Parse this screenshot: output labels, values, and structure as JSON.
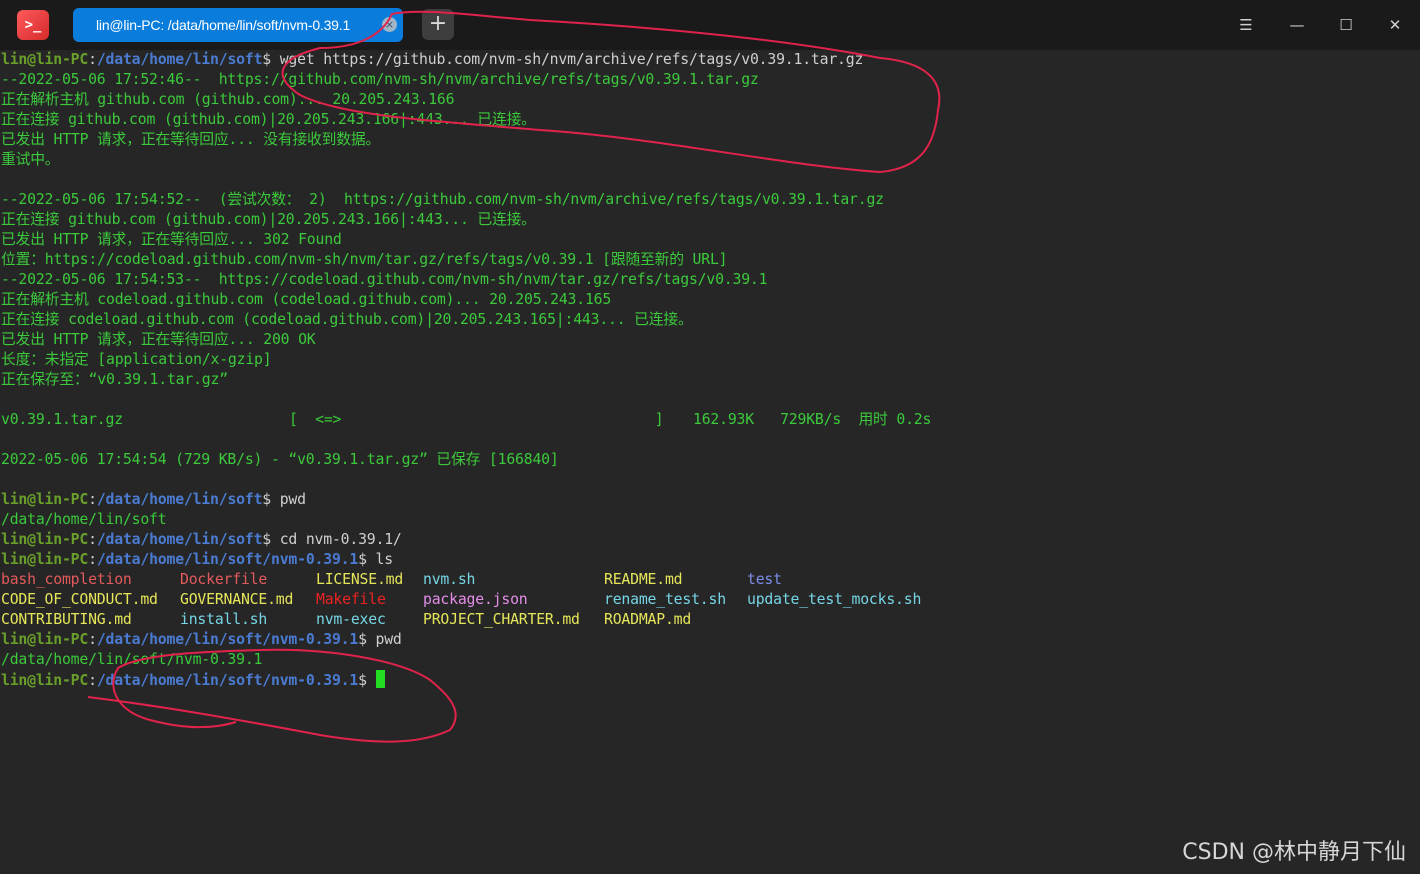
{
  "window": {
    "tab_title": "lin@lin-PC: /data/home/lin/soft/nvm-0.39.1",
    "tab_close": "×",
    "new_tab": "+",
    "menu": "☰",
    "minimize": "—",
    "maximize": "☐",
    "close": "✕"
  },
  "terminal": {
    "wget": {
      "user": "lin@lin-PC",
      "path": "/data/home/lin/soft",
      "cmd": "$ wget https://github.com/nvm-sh/nvm/archive/refs/tags/v0.39.1.tar.gz"
    },
    "l2": "--2022-05-06 17:52:46--  https://github.com/nvm-sh/nvm/archive/refs/tags/v0.39.1.tar.gz",
    "l3": "正在解析主机 github.com (github.com)... 20.205.243.166",
    "l4": "正在连接 github.com (github.com)|20.205.243.166|:443... 已连接。",
    "l5": "已发出 HTTP 请求，正在等待回应... 没有接收到数据。",
    "l6": "重试中。",
    "l7": "--2022-05-06 17:54:52--  (尝试次数： 2)  https://github.com/nvm-sh/nvm/archive/refs/tags/v0.39.1.tar.gz",
    "l8": "正在连接 github.com (github.com)|20.205.243.166|:443... 已连接。",
    "l9": "已发出 HTTP 请求，正在等待回应... 302 Found",
    "l10": "位置：https://codeload.github.com/nvm-sh/nvm/tar.gz/refs/tags/v0.39.1 [跟随至新的 URL]",
    "l11": "--2022-05-06 17:54:53--  https://codeload.github.com/nvm-sh/nvm/tar.gz/refs/tags/v0.39.1",
    "l12": "正在解析主机 codeload.github.com (codeload.github.com)... 20.205.243.165",
    "l13": "正在连接 codeload.github.com (codeload.github.com)|20.205.243.165|:443... 已连接。",
    "l14": "已发出 HTTP 请求，正在等待回应... 200 OK",
    "l15": "长度：未指定 [application/x-gzip]",
    "l16": "正在保存至：“v0.39.1.tar.gz”",
    "progress": {
      "file": "v0.39.1.tar.gz",
      "bar": "[  <=>                                    ]",
      "stats": "162.93K   729KB/s  用时 0.2s"
    },
    "saved": "2022-05-06 17:54:54 (729 KB/s) - “v0.39.1.tar.gz” 已保存 [166840]",
    "pwd1": {
      "user": "lin@lin-PC",
      "path": "/data/home/lin/soft",
      "cmd": "$ pwd"
    },
    "pwd1_out": "/data/home/lin/soft",
    "cd": {
      "user": "lin@lin-PC",
      "path": "/data/home/lin/soft",
      "cmd": "$ cd nvm-0.39.1/"
    },
    "ls": {
      "user": "lin@lin-PC",
      "path": "/data/home/lin/soft/nvm-0.39.1",
      "cmd": "$ ls"
    },
    "files": {
      "bash_completion": "bash_completion",
      "Dockerfile": "Dockerfile",
      "LICENSE": "LICENSE.md",
      "nvm_sh": "nvm.sh",
      "README": "README.md",
      "test": "test",
      "CODE_OF_CONDUCT": "CODE_OF_CONDUCT.md",
      "GOVERNANCE": "GOVERNANCE.md",
      "Makefile": "Makefile",
      "package_json": "package.json",
      "rename_test": "rename_test.sh",
      "update_test_mocks": "update_test_mocks.sh",
      "CONTRIBUTING": "CONTRIBUTING.md",
      "install_sh": "install.sh",
      "nvm_exec": "nvm-exec",
      "PROJECT_CHARTER": "PROJECT_CHARTER.md",
      "ROADMAP": "ROADMAP.md"
    },
    "pwd2": {
      "user": "lin@lin-PC",
      "path": "/data/home/lin/soft/nvm-0.39.1",
      "cmd": "$ pwd"
    },
    "pwd2_out": "/data/home/lin/soft/nvm-0.39.1",
    "prompt": {
      "user": "lin@lin-PC",
      "path": "/data/home/lin/soft/nvm-0.39.1",
      "cmd": "$ "
    }
  },
  "watermark": "CSDN @林中静月下仙",
  "colors": {
    "background": "#262626",
    "green_text": "#3cc93c",
    "prompt_user": "#6a9e2b",
    "prompt_path": "#4b7bd1",
    "tab_blue": "#0a7ddc",
    "annotation_red": "#e0234a"
  }
}
